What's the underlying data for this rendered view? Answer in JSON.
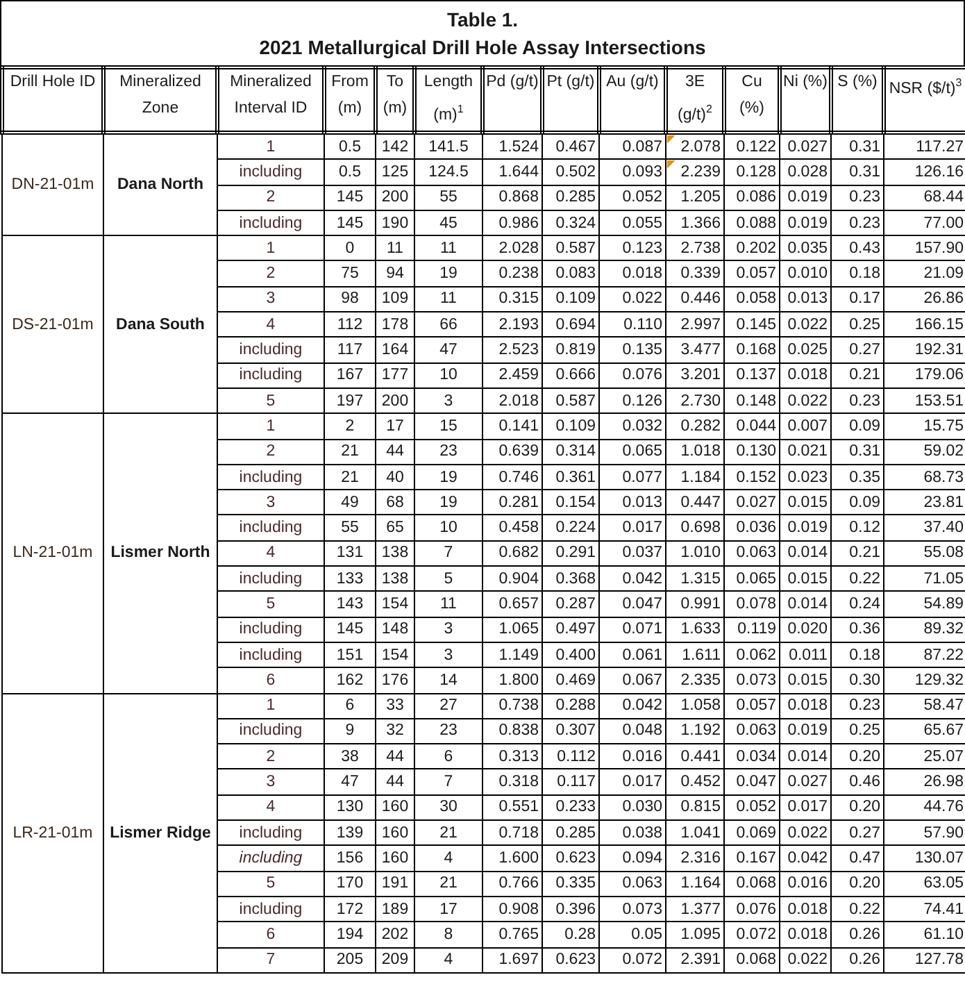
{
  "title": [
    "Table 1.",
    "2021 Metallurgical Drill Hole Assay Intersections"
  ],
  "columns": [
    "Drill Hole ID",
    "Mineralized Zone",
    "Mineralized Interval ID",
    "From (m)",
    "To (m)",
    "Length (m)$^{1}$",
    "Pd (g/t)",
    "Pt (g/t)",
    "Au (g/t)",
    "3E (g/t)$^{2}$",
    "Cu (%)",
    "Ni (%)",
    "S (%)",
    "NSR ($/t)$^{3}$"
  ],
  "holes": [
    {
      "hole_id": "DN-21-01m",
      "zone": "Dana North",
      "rows": [
        {
          "interval": "1",
          "italic": false,
          "flagged": true,
          "values": [
            "0.5",
            "142",
            "141.5",
            "1.524",
            "0.467",
            "0.087",
            "2.078",
            "0.122",
            "0.027",
            "0.31",
            "117.27"
          ]
        },
        {
          "interval": "including",
          "italic": false,
          "flagged": true,
          "values": [
            "0.5",
            "125",
            "124.5",
            "1.644",
            "0.502",
            "0.093",
            "2.239",
            "0.128",
            "0.028",
            "0.31",
            "126.16"
          ]
        },
        {
          "interval": "2",
          "italic": false,
          "flagged": false,
          "values": [
            "145",
            "200",
            "55",
            "0.868",
            "0.285",
            "0.052",
            "1.205",
            "0.086",
            "0.019",
            "0.23",
            "68.44"
          ]
        },
        {
          "interval": "including",
          "italic": false,
          "flagged": false,
          "values": [
            "145",
            "190",
            "45",
            "0.986",
            "0.324",
            "0.055",
            "1.366",
            "0.088",
            "0.019",
            "0.23",
            "77.00"
          ]
        }
      ]
    },
    {
      "hole_id": "DS-21-01m",
      "zone": "Dana South",
      "rows": [
        {
          "interval": "1",
          "italic": false,
          "flagged": false,
          "values": [
            "0",
            "11",
            "11",
            "2.028",
            "0.587",
            "0.123",
            "2.738",
            "0.202",
            "0.035",
            "0.43",
            "157.90"
          ]
        },
        {
          "interval": "2",
          "italic": false,
          "flagged": false,
          "values": [
            "75",
            "94",
            "19",
            "0.238",
            "0.083",
            "0.018",
            "0.339",
            "0.057",
            "0.010",
            "0.18",
            "21.09"
          ]
        },
        {
          "interval": "3",
          "italic": false,
          "flagged": false,
          "values": [
            "98",
            "109",
            "11",
            "0.315",
            "0.109",
            "0.022",
            "0.446",
            "0.058",
            "0.013",
            "0.17",
            "26.86"
          ]
        },
        {
          "interval": "4",
          "italic": false,
          "flagged": false,
          "values": [
            "112",
            "178",
            "66",
            "2.193",
            "0.694",
            "0.110",
            "2.997",
            "0.145",
            "0.022",
            "0.25",
            "166.15"
          ]
        },
        {
          "interval": "including",
          "italic": false,
          "flagged": false,
          "values": [
            "117",
            "164",
            "47",
            "2.523",
            "0.819",
            "0.135",
            "3.477",
            "0.168",
            "0.025",
            "0.27",
            "192.31"
          ]
        },
        {
          "interval": "including",
          "italic": false,
          "flagged": false,
          "values": [
            "167",
            "177",
            "10",
            "2.459",
            "0.666",
            "0.076",
            "3.201",
            "0.137",
            "0.018",
            "0.21",
            "179.06"
          ]
        },
        {
          "interval": "5",
          "italic": false,
          "flagged": false,
          "values": [
            "197",
            "200",
            "3",
            "2.018",
            "0.587",
            "0.126",
            "2.730",
            "0.148",
            "0.022",
            "0.23",
            "153.51"
          ]
        }
      ]
    },
    {
      "hole_id": "LN-21-01m",
      "zone": "Lismer North",
      "rows": [
        {
          "interval": "1",
          "italic": false,
          "flagged": false,
          "values": [
            "2",
            "17",
            "15",
            "0.141",
            "0.109",
            "0.032",
            "0.282",
            "0.044",
            "0.007",
            "0.09",
            "15.75"
          ]
        },
        {
          "interval": "2",
          "italic": false,
          "flagged": false,
          "values": [
            "21",
            "44",
            "23",
            "0.639",
            "0.314",
            "0.065",
            "1.018",
            "0.130",
            "0.021",
            "0.31",
            "59.02"
          ]
        },
        {
          "interval": "including",
          "italic": false,
          "flagged": false,
          "values": [
            "21",
            "40",
            "19",
            "0.746",
            "0.361",
            "0.077",
            "1.184",
            "0.152",
            "0.023",
            "0.35",
            "68.73"
          ]
        },
        {
          "interval": "3",
          "italic": false,
          "flagged": false,
          "values": [
            "49",
            "68",
            "19",
            "0.281",
            "0.154",
            "0.013",
            "0.447",
            "0.027",
            "0.015",
            "0.09",
            "23.81"
          ]
        },
        {
          "interval": "including",
          "italic": false,
          "flagged": false,
          "values": [
            "55",
            "65",
            "10",
            "0.458",
            "0.224",
            "0.017",
            "0.698",
            "0.036",
            "0.019",
            "0.12",
            "37.40"
          ]
        },
        {
          "interval": "4",
          "italic": false,
          "flagged": false,
          "values": [
            "131",
            "138",
            "7",
            "0.682",
            "0.291",
            "0.037",
            "1.010",
            "0.063",
            "0.014",
            "0.21",
            "55.08"
          ]
        },
        {
          "interval": "including",
          "italic": false,
          "flagged": false,
          "values": [
            "133",
            "138",
            "5",
            "0.904",
            "0.368",
            "0.042",
            "1.315",
            "0.065",
            "0.015",
            "0.22",
            "71.05"
          ]
        },
        {
          "interval": "5",
          "italic": false,
          "flagged": false,
          "values": [
            "143",
            "154",
            "11",
            "0.657",
            "0.287",
            "0.047",
            "0.991",
            "0.078",
            "0.014",
            "0.24",
            "54.89"
          ]
        },
        {
          "interval": "including",
          "italic": false,
          "flagged": false,
          "values": [
            "145",
            "148",
            "3",
            "1.065",
            "0.497",
            "0.071",
            "1.633",
            "0.119",
            "0.020",
            "0.36",
            "89.32"
          ]
        },
        {
          "interval": "including",
          "italic": false,
          "flagged": false,
          "values": [
            "151",
            "154",
            "3",
            "1.149",
            "0.400",
            "0.061",
            "1.611",
            "0.062",
            "0.011",
            "0.18",
            "87.22"
          ]
        },
        {
          "interval": "6",
          "italic": false,
          "flagged": false,
          "values": [
            "162",
            "176",
            "14",
            "1.800",
            "0.469",
            "0.067",
            "2.335",
            "0.073",
            "0.015",
            "0.30",
            "129.32"
          ]
        }
      ]
    },
    {
      "hole_id": "LR-21-01m",
      "zone": "Lismer Ridge",
      "rows": [
        {
          "interval": "1",
          "italic": false,
          "flagged": false,
          "values": [
            "6",
            "33",
            "27",
            "0.738",
            "0.288",
            "0.042",
            "1.058",
            "0.057",
            "0.018",
            "0.23",
            "58.47"
          ]
        },
        {
          "interval": "including",
          "italic": false,
          "flagged": false,
          "values": [
            "9",
            "32",
            "23",
            "0.838",
            "0.307",
            "0.048",
            "1.192",
            "0.063",
            "0.019",
            "0.25",
            "65.67"
          ]
        },
        {
          "interval": "2",
          "italic": false,
          "flagged": false,
          "values": [
            "38",
            "44",
            "6",
            "0.313",
            "0.112",
            "0.016",
            "0.441",
            "0.034",
            "0.014",
            "0.20",
            "25.07"
          ]
        },
        {
          "interval": "3",
          "italic": false,
          "flagged": false,
          "values": [
            "47",
            "44",
            "7",
            "0.318",
            "0.117",
            "0.017",
            "0.452",
            "0.047",
            "0.027",
            "0.46",
            "26.98"
          ]
        },
        {
          "interval": "4",
          "italic": false,
          "flagged": false,
          "values": [
            "130",
            "160",
            "30",
            "0.551",
            "0.233",
            "0.030",
            "0.815",
            "0.052",
            "0.017",
            "0.20",
            "44.76"
          ]
        },
        {
          "interval": "including",
          "italic": false,
          "flagged": false,
          "values": [
            "139",
            "160",
            "21",
            "0.718",
            "0.285",
            "0.038",
            "1.041",
            "0.069",
            "0.022",
            "0.27",
            "57.90"
          ]
        },
        {
          "interval": "including",
          "italic": true,
          "flagged": false,
          "values": [
            "156",
            "160",
            "4",
            "1.600",
            "0.623",
            "0.094",
            "2.316",
            "0.167",
            "0.042",
            "0.47",
            "130.07"
          ]
        },
        {
          "interval": "5",
          "italic": false,
          "flagged": false,
          "values": [
            "170",
            "191",
            "21",
            "0.766",
            "0.335",
            "0.063",
            "1.164",
            "0.068",
            "0.016",
            "0.20",
            "63.05"
          ]
        },
        {
          "interval": "including",
          "italic": false,
          "flagged": false,
          "values": [
            "172",
            "189",
            "17",
            "0.908",
            "0.396",
            "0.073",
            "1.377",
            "0.076",
            "0.018",
            "0.22",
            "74.41"
          ]
        },
        {
          "interval": "6",
          "italic": false,
          "flagged": false,
          "values": [
            "194",
            "202",
            "8",
            "0.765",
            "0.28",
            "0.05",
            "1.095",
            "0.072",
            "0.018",
            "0.26",
            "61.10"
          ]
        },
        {
          "interval": "7",
          "italic": false,
          "flagged": false,
          "values": [
            "205",
            "209",
            "4",
            "1.697",
            "0.623",
            "0.072",
            "2.391",
            "0.068",
            "0.022",
            "0.26",
            "127.78"
          ]
        }
      ]
    }
  ]
}
